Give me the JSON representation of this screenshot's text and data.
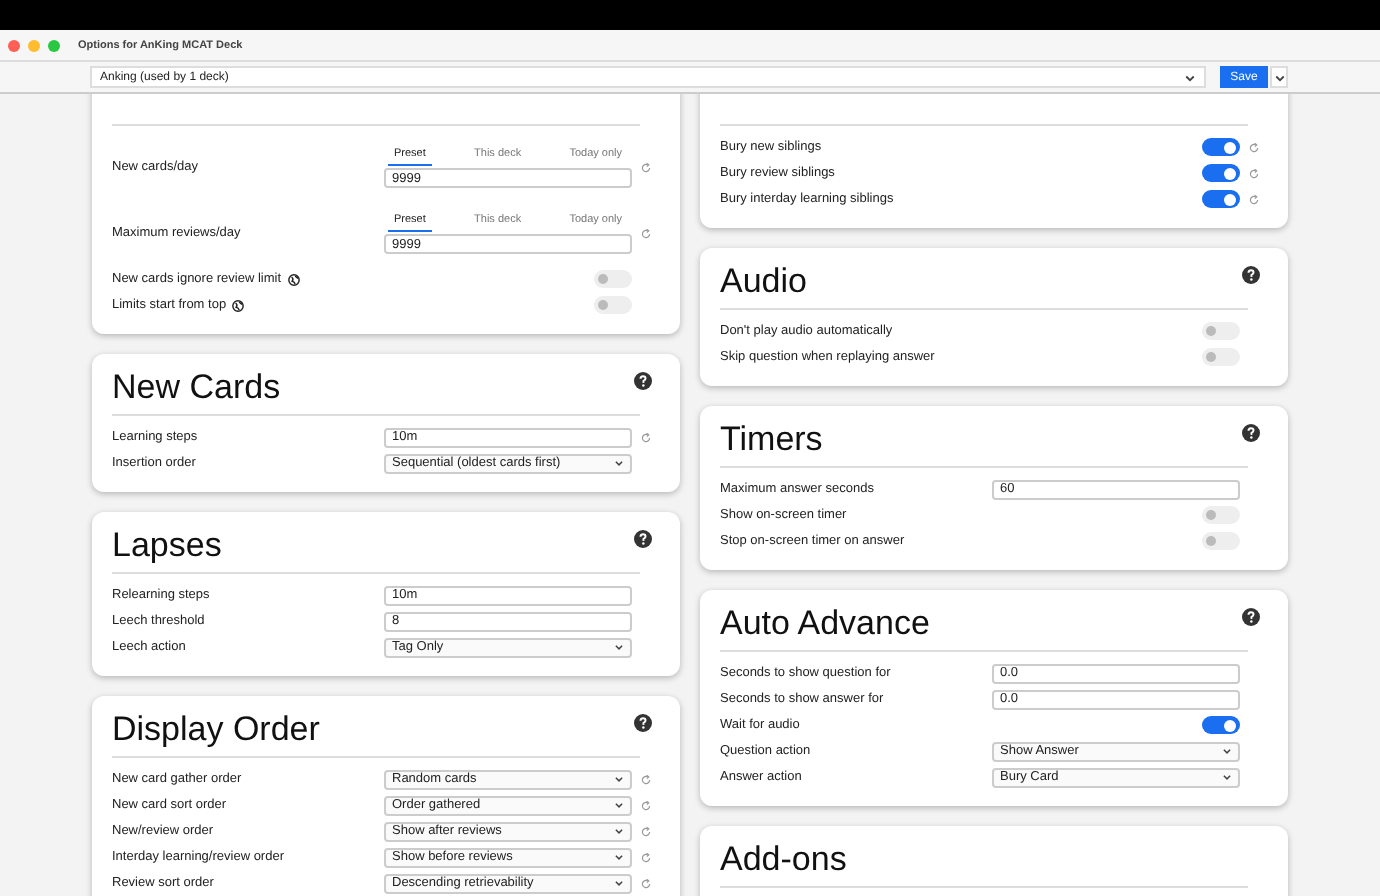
{
  "window": {
    "title": "Options for AnKing MCAT Deck"
  },
  "toolbar": {
    "preset": "Anking (used by 1 deck)",
    "save": "Save"
  },
  "columns": [
    {
      "cards": [
        {
          "help": false,
          "rows": [
            {
              "kind": "limit",
              "label": "New cards/day",
              "tabs": [
                {
                  "label": "Preset",
                  "selected": true
                },
                {
                  "label": "This deck",
                  "selected": false
                },
                {
                  "label": "Today only",
                  "selected": false
                }
              ],
              "value": "9999",
              "reset": true
            },
            {
              "kind": "limit",
              "label": "Maximum reviews/day",
              "tabs": [
                {
                  "label": "Preset",
                  "selected": true
                },
                {
                  "label": "This deck",
                  "selected": false
                },
                {
                  "label": "Today only",
                  "selected": false
                }
              ],
              "value": "9999",
              "reset": true
            },
            {
              "kind": "toggle",
              "label": "New cards ignore review limit",
              "globe": true,
              "on": false,
              "reset": false
            },
            {
              "kind": "toggle",
              "label": "Limits start from top",
              "globe": true,
              "on": false,
              "reset": false
            }
          ]
        },
        {
          "title": "New Cards",
          "help": true,
          "rows": [
            {
              "kind": "input",
              "label": "Learning steps",
              "value": "10m",
              "reset": true
            },
            {
              "kind": "select",
              "label": "Insertion order",
              "value": "Sequential (oldest cards first)",
              "reset": false
            }
          ]
        },
        {
          "title": "Lapses",
          "help": true,
          "rows": [
            {
              "kind": "input",
              "label": "Relearning steps",
              "value": "10m",
              "reset": false
            },
            {
              "kind": "input",
              "label": "Leech threshold",
              "value": "8",
              "reset": false
            },
            {
              "kind": "select",
              "label": "Leech action",
              "value": "Tag Only",
              "reset": false
            }
          ]
        },
        {
          "title": "Display Order",
          "help": true,
          "rows": [
            {
              "kind": "select",
              "label": "New card gather order",
              "value": "Random cards",
              "reset": true
            },
            {
              "kind": "select",
              "label": "New card sort order",
              "value": "Order gathered",
              "reset": true
            },
            {
              "kind": "select",
              "label": "New/review order",
              "value": "Show after reviews",
              "reset": true
            },
            {
              "kind": "select",
              "label": "Interday learning/review order",
              "value": "Show before reviews",
              "reset": true
            },
            {
              "kind": "select",
              "label": "Review sort order",
              "value": "Descending retrievability",
              "reset": true
            }
          ]
        }
      ]
    },
    {
      "cards": [
        {
          "help": false,
          "rows": [
            {
              "kind": "toggle",
              "label": "Bury new siblings",
              "globe": false,
              "on": true,
              "reset": true
            },
            {
              "kind": "toggle",
              "label": "Bury review siblings",
              "globe": false,
              "on": true,
              "reset": true
            },
            {
              "kind": "toggle",
              "label": "Bury interday learning siblings",
              "globe": false,
              "on": true,
              "reset": true
            }
          ]
        },
        {
          "title": "Audio",
          "help": true,
          "rows": [
            {
              "kind": "toggle",
              "label": "Don't play audio automatically",
              "globe": false,
              "on": false,
              "reset": false
            },
            {
              "kind": "toggle",
              "label": "Skip question when replaying answer",
              "globe": false,
              "on": false,
              "reset": false
            }
          ]
        },
        {
          "title": "Timers",
          "help": true,
          "rows": [
            {
              "kind": "input",
              "label": "Maximum answer seconds",
              "value": "60",
              "reset": false
            },
            {
              "kind": "toggle",
              "label": "Show on-screen timer",
              "globe": false,
              "on": false,
              "reset": false
            },
            {
              "kind": "toggle",
              "label": "Stop on-screen timer on answer",
              "globe": false,
              "on": false,
              "reset": false
            }
          ]
        },
        {
          "title": "Auto Advance",
          "help": true,
          "rows": [
            {
              "kind": "input",
              "label": "Seconds to show question for",
              "value": "0.0",
              "reset": false
            },
            {
              "kind": "input",
              "label": "Seconds to show answer for",
              "value": "0.0",
              "reset": false
            },
            {
              "kind": "toggle",
              "label": "Wait for audio",
              "globe": false,
              "on": true,
              "reset": false
            },
            {
              "kind": "select",
              "label": "Question action",
              "value": "Show Answer",
              "reset": false
            },
            {
              "kind": "select",
              "label": "Answer action",
              "value": "Bury Card",
              "reset": false
            }
          ]
        },
        {
          "title": "Add-ons",
          "help": false
        }
      ]
    }
  ]
}
